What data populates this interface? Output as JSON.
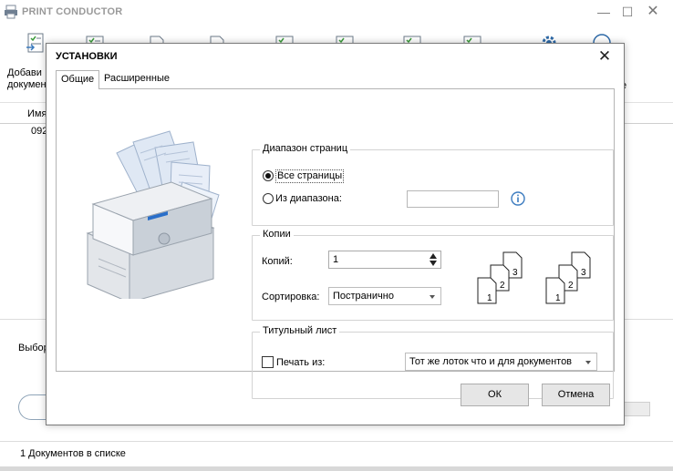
{
  "app": {
    "title": "PRINT CONDUCTOR",
    "toolbar_add_label_line1": "Добави",
    "toolbar_add_label_line2": "докумен",
    "toolbar_right_label": "е",
    "list_header_name": "Имя",
    "list_row_1": "092",
    "select_label": "Выбор",
    "status_text": "1 Документов в списке"
  },
  "dialog": {
    "title": "УСТАНОВКИ",
    "tabs": [
      {
        "label": "Общие",
        "active": true
      },
      {
        "label": "Расширенные",
        "active": false
      }
    ],
    "page_range": {
      "title": "Диапазон страниц",
      "all_pages_label": "Все страницы",
      "all_pages_selected": true,
      "from_range_label": "Из диапазона:",
      "range_value": ""
    },
    "copies": {
      "title": "Копии",
      "copies_label": "Копий:",
      "copies_value": "1",
      "sort_label": "Сортировка:",
      "sort_value": "Постранично"
    },
    "cover_page": {
      "title": "Титульный лист",
      "print_from_label": "Печать из:",
      "print_from_checked": false,
      "tray_value": "Тот же лоток что и для документов"
    },
    "buttons": {
      "ok": "ОК",
      "cancel": "Отмена"
    }
  },
  "colors": {
    "info_icon": "#3b7bbf",
    "printer_accent": "#2a6fc9"
  }
}
